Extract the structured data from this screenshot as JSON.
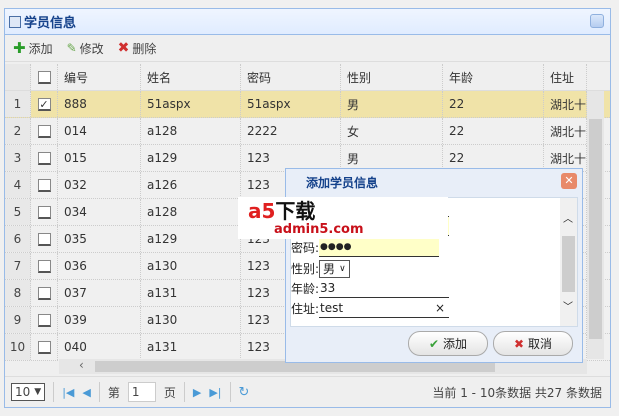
{
  "panel": {
    "title": "学员信息"
  },
  "toolbar": {
    "add": "添加",
    "edit": "修改",
    "delete": "删除"
  },
  "grid": {
    "columns": [
      "编号",
      "姓名",
      "密码",
      "性别",
      "年龄",
      "住址"
    ],
    "rows": [
      {
        "n": "1",
        "checked": true,
        "cells": [
          "888",
          "51aspx",
          "51aspx",
          "男",
          "22",
          "湖北十堰"
        ]
      },
      {
        "n": "2",
        "checked": false,
        "cells": [
          "014",
          "a128",
          "2222",
          "女",
          "22",
          "湖北十堰"
        ]
      },
      {
        "n": "3",
        "checked": false,
        "cells": [
          "015",
          "a129",
          "123",
          "男",
          "22",
          "湖北十堰"
        ]
      },
      {
        "n": "4",
        "checked": false,
        "cells": [
          "032",
          "a126",
          "123",
          "",
          "",
          ""
        ]
      },
      {
        "n": "5",
        "checked": false,
        "cells": [
          "034",
          "a128",
          "123",
          "",
          "",
          ""
        ]
      },
      {
        "n": "6",
        "checked": false,
        "cells": [
          "035",
          "a129",
          "123",
          "",
          "",
          ""
        ]
      },
      {
        "n": "7",
        "checked": false,
        "cells": [
          "036",
          "a130",
          "123",
          "",
          "",
          ""
        ]
      },
      {
        "n": "8",
        "checked": false,
        "cells": [
          "037",
          "a131",
          "123",
          "",
          "",
          ""
        ]
      },
      {
        "n": "9",
        "checked": false,
        "cells": [
          "039",
          "a130",
          "123",
          "",
          "",
          ""
        ]
      },
      {
        "n": "10",
        "checked": false,
        "cells": [
          "040",
          "a131",
          "123",
          "",
          "",
          ""
        ]
      }
    ]
  },
  "pager": {
    "page_size": "10",
    "page_prefix": "第",
    "page": "1",
    "page_suffix": "页",
    "info": "当前 1 - 10条数据 共27 条数据"
  },
  "dialog": {
    "title": "添加学员信息",
    "pwd_label": "密码:",
    "pwd_value": "●●●●",
    "sex_label": "性别:",
    "sex_value": "男",
    "age_label": "年龄:",
    "age_value": "33",
    "addr_label": "住址:",
    "addr_value": "test",
    "clear": "×",
    "ok": "添加",
    "cancel": "取消"
  },
  "watermark": {
    "text1": "a5",
    "text2": "下载",
    "text3": "admin5.com"
  },
  "colors": {
    "accent": "#15428b",
    "selected_row": "#f0e3a8",
    "input_highlight": "#ffffc8"
  }
}
